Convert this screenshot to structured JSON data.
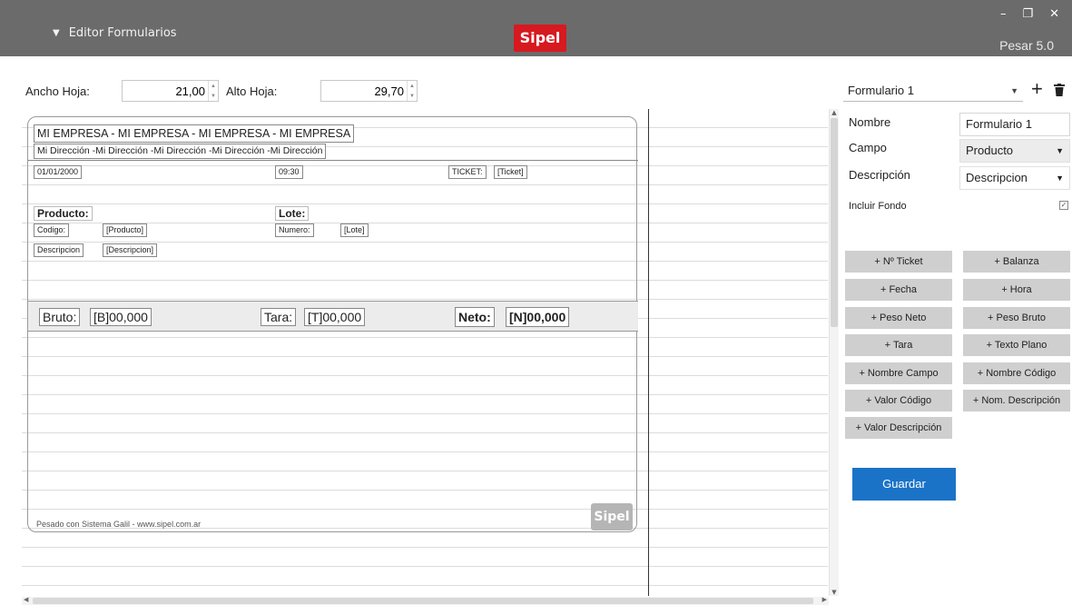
{
  "titlebar": {
    "menu_label": "Editor Formularios",
    "logo": "Sipel",
    "app_name": "Pesar 5.0",
    "minimize": "–",
    "restore": "❐",
    "close": "✕"
  },
  "page_setup": {
    "width_label": "Ancho Hoja:",
    "width_value": "21,00",
    "height_label": "Alto Hoja:",
    "height_value": "29,70"
  },
  "sheet": {
    "company_title": "MI EMPRESA - MI EMPRESA - MI EMPRESA - MI EMPRESA",
    "company_address": "Mi Dirección -Mi Dirección -Mi Dirección -Mi Dirección -Mi Dirección",
    "date": "01/01/2000",
    "time": "09:30",
    "ticket_label": "TICKET:",
    "ticket_value": "[Ticket]",
    "product_title": "Producto:",
    "code_label": "Codigo:",
    "code_value": "[Producto]",
    "desc_label": "Descripcion",
    "desc_value": "[Descripcion]",
    "lot_title": "Lote:",
    "number_label": "Numero:",
    "number_value": "[Lote]",
    "gross_label": "Bruto:",
    "gross_value": "[B]00,000",
    "tare_label": "Tara:",
    "tare_value": "[T]00,000",
    "net_label": "Neto:",
    "net_value": "[N]00,000",
    "footer": "Pesado con Sistema Galil - www.sipel.com.ar",
    "footer_logo": "Sipel"
  },
  "panel": {
    "form_selected": "Formulario 1",
    "name_label": "Nombre",
    "name_value": "Formulario 1",
    "field_label": "Campo",
    "field_value": "Producto",
    "desc_label": "Descripción",
    "desc_value": "Descripcion",
    "include_bg_label": "Incluir Fondo",
    "include_bg_checked": true,
    "buttons": [
      "+ Nº Ticket",
      "+ Balanza",
      "+ Fecha",
      "+ Hora",
      "+ Peso Neto",
      "+ Peso Bruto",
      "+ Tara",
      "+ Texto Plano",
      "+ Nombre Campo",
      "+ Nombre Código",
      "+ Valor Código",
      "+ Nom. Descripción",
      "+ Valor Descripción"
    ],
    "save_label": "Guardar"
  },
  "colors": {
    "titlebar": "#6b6b6b",
    "brand_red": "#d71920",
    "save_blue": "#1a73c7",
    "button_gray": "#cfcfcf"
  }
}
